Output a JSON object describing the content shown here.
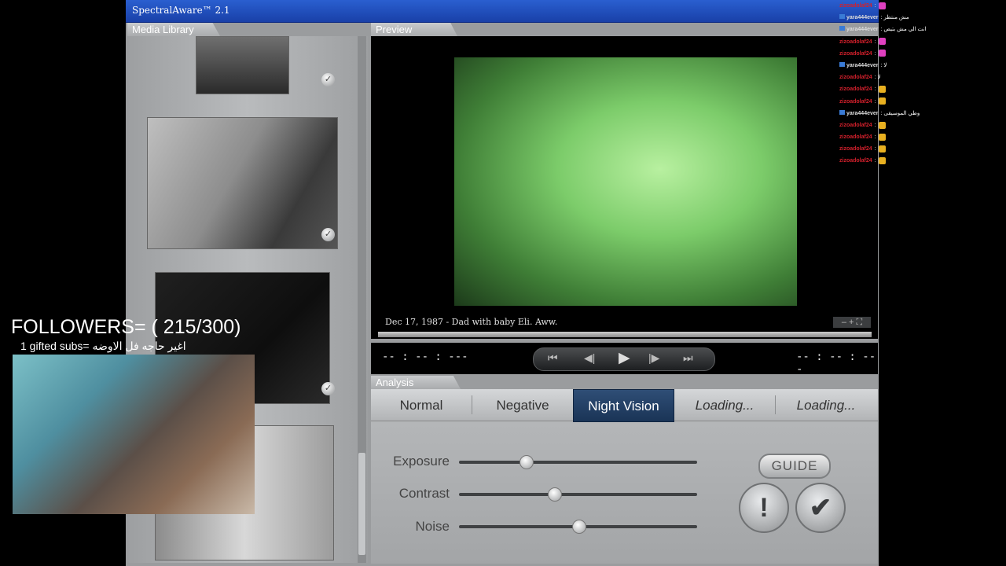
{
  "app": {
    "title": "SpectralAware™ 2.1",
    "colors": {
      "titlebar": "#1f4fc0",
      "active_mode": "#233f66",
      "night_vision_tint": "#7ccc6a"
    }
  },
  "media_library": {
    "tab_label": "Media Library",
    "thumb_check": "✓"
  },
  "preview": {
    "tab_label": "Preview",
    "caption": "Dec 17, 1987 - Dad with baby Eli. Aww.",
    "zoom_controls": "– + ⛶",
    "time_left": "-- : -- : ---",
    "time_right": "-- : -- : ---",
    "transport": {
      "rewind": "⏮",
      "prev": "◀|",
      "play": "▶",
      "next": "|▶",
      "forward": "⏭"
    }
  },
  "analysis": {
    "tab_label": "Analysis",
    "modes": [
      "Normal",
      "Negative",
      "Night Vision",
      "Loading...",
      "Loading..."
    ],
    "active_mode": "Night Vision",
    "sliders": [
      {
        "label": "Exposure",
        "value": 0.28
      },
      {
        "label": "Contrast",
        "value": 0.4
      },
      {
        "label": "Noise",
        "value": 0.5
      }
    ],
    "guide_label": "GUIDE",
    "alert_label": "!",
    "confirm_label": "✔"
  },
  "stream_overlay": {
    "followers": "FOLLOWERS= ( 215/300)",
    "gifted": "1 gifted subs= اغير حاجه فل الاوضه"
  },
  "chat": [
    {
      "user": "zizoadolaf24",
      "text": ":",
      "emote": "#e040c0",
      "user_color": "#d4202c"
    },
    {
      "user": "yara444ever",
      "text": ": مش منتظر",
      "emote": "",
      "user_color": "#dddddd"
    },
    {
      "user": "yara444ever",
      "text": ": انت الي مش بتيص",
      "emote": "",
      "user_color": "#dddddd"
    },
    {
      "user": "zizoadolaf24",
      "text": ":",
      "emote": "#e040c0",
      "user_color": "#d4202c"
    },
    {
      "user": "zizoadolaf24",
      "text": ":",
      "emote": "#e040c0",
      "user_color": "#d4202c"
    },
    {
      "user": "yara444ever",
      "text": ": لا",
      "emote": "",
      "user_color": "#dddddd"
    },
    {
      "user": "zizoadolaf24",
      "text": ": لا",
      "emote": "",
      "user_color": "#d4202c"
    },
    {
      "user": "zizoadolaf24",
      "text": ":",
      "emote": "#e8b020",
      "user_color": "#d4202c"
    },
    {
      "user": "zizoadolaf24",
      "text": ":",
      "emote": "#e8b020",
      "user_color": "#d4202c"
    },
    {
      "user": "yara444ever",
      "text": ": وطي الموسيقى",
      "emote": "",
      "user_color": "#dddddd"
    },
    {
      "user": "zizoadolaf24",
      "text": ":",
      "emote": "#e8b020",
      "user_color": "#d4202c"
    },
    {
      "user": "zizoadolaf24",
      "text": ":",
      "emote": "#e8b020",
      "user_color": "#d4202c"
    },
    {
      "user": "zizoadolaf24",
      "text": ":",
      "emote": "#e8b020",
      "user_color": "#d4202c"
    },
    {
      "user": "zizoadolaf24",
      "text": ":",
      "emote": "#e8b020",
      "user_color": "#d4202c"
    }
  ]
}
